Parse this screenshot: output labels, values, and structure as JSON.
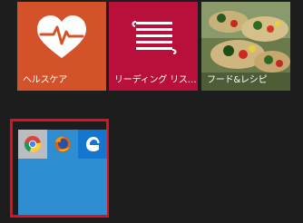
{
  "tiles": {
    "health": {
      "label": "ヘルスケア",
      "icon": "heart-pulse-icon",
      "color": "#d4522a"
    },
    "reading": {
      "label": "リーディング リス…",
      "icon": "reading-list-icon",
      "color": "#b8103a"
    },
    "food": {
      "label": "フード&レシピ",
      "icon": "food-photo",
      "color": "#3b5a2a"
    }
  },
  "group": {
    "highlight_color": "#e01020",
    "tile_color": "#2f8dd1",
    "apps": [
      {
        "name": "Google Chrome",
        "icon": "chrome-icon"
      },
      {
        "name": "Firefox",
        "icon": "firefox-icon"
      },
      {
        "name": "Microsoft Edge",
        "icon": "edge-icon"
      }
    ]
  }
}
